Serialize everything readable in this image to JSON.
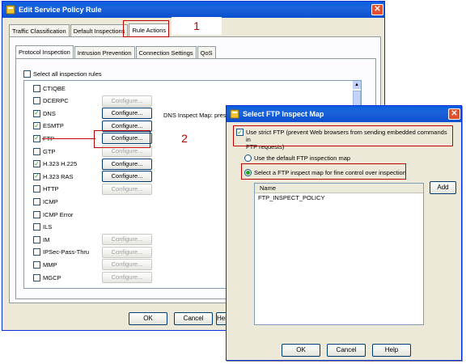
{
  "main_dialog": {
    "title": "Edit Service Policy Rule",
    "tabs": [
      "Traffic Classification",
      "Default Inspections",
      "Rule Actions"
    ],
    "subtabs": [
      "Protocol Inspection",
      "Intrusion Prevention",
      "Connection Settings",
      "QoS"
    ],
    "select_all_label": "Select all inspection rules",
    "rules": [
      {
        "name": "CTIQBE",
        "checked": false,
        "configure": "none"
      },
      {
        "name": "DCERPC",
        "checked": false,
        "configure": "disabled"
      },
      {
        "name": "DNS",
        "checked": true,
        "configure": "enabled"
      },
      {
        "name": "ESMTP",
        "checked": true,
        "configure": "enabled"
      },
      {
        "name": "FTP",
        "checked": true,
        "configure": "enabled"
      },
      {
        "name": "GTP",
        "checked": false,
        "configure": "disabled"
      },
      {
        "name": "H.323 H.225",
        "checked": true,
        "configure": "enabled"
      },
      {
        "name": "H.323 RAS",
        "checked": true,
        "configure": "enabled"
      },
      {
        "name": "HTTP",
        "checked": false,
        "configure": "disabled"
      },
      {
        "name": "ICMP",
        "checked": false,
        "configure": "none"
      },
      {
        "name": "ICMP Error",
        "checked": false,
        "configure": "none"
      },
      {
        "name": "ILS",
        "checked": false,
        "configure": "none"
      },
      {
        "name": "IM",
        "checked": false,
        "configure": "disabled"
      },
      {
        "name": "IPSec-Pass-Thru",
        "checked": false,
        "configure": "disabled"
      },
      {
        "name": "MMP",
        "checked": false,
        "configure": "disabled"
      },
      {
        "name": "MGCP",
        "checked": false,
        "configure": "disabled"
      }
    ],
    "configure_label": "Configure...",
    "dns_note": "DNS Inspect Map: prese",
    "buttons": {
      "ok": "OK",
      "cancel": "Cancel",
      "help": "Help"
    }
  },
  "callouts": {
    "one": "1",
    "two": "2"
  },
  "ftp_dialog": {
    "title": "Select FTP Inspect Map",
    "strict_ftp_label_line1": "Use strict FTP (prevent Web browsers from sending embedded commands in",
    "strict_ftp_label_line2": "FTP requests)",
    "strict_ftp_checked": true,
    "radio_default": "Use the default FTP inspection map",
    "radio_select": "Select a FTP inspect map for fine control over inspection",
    "selected_radio": "select",
    "table_header": "Name",
    "table_rows": [
      "FTP_INSPECT_POLICY"
    ],
    "add_label": "Add",
    "buttons": {
      "ok": "OK",
      "cancel": "Cancel",
      "help": "Help"
    }
  },
  "colors": {
    "title_blue": "#0a5fe0",
    "callout_red": "#b00000",
    "check_green": "#21a121"
  }
}
